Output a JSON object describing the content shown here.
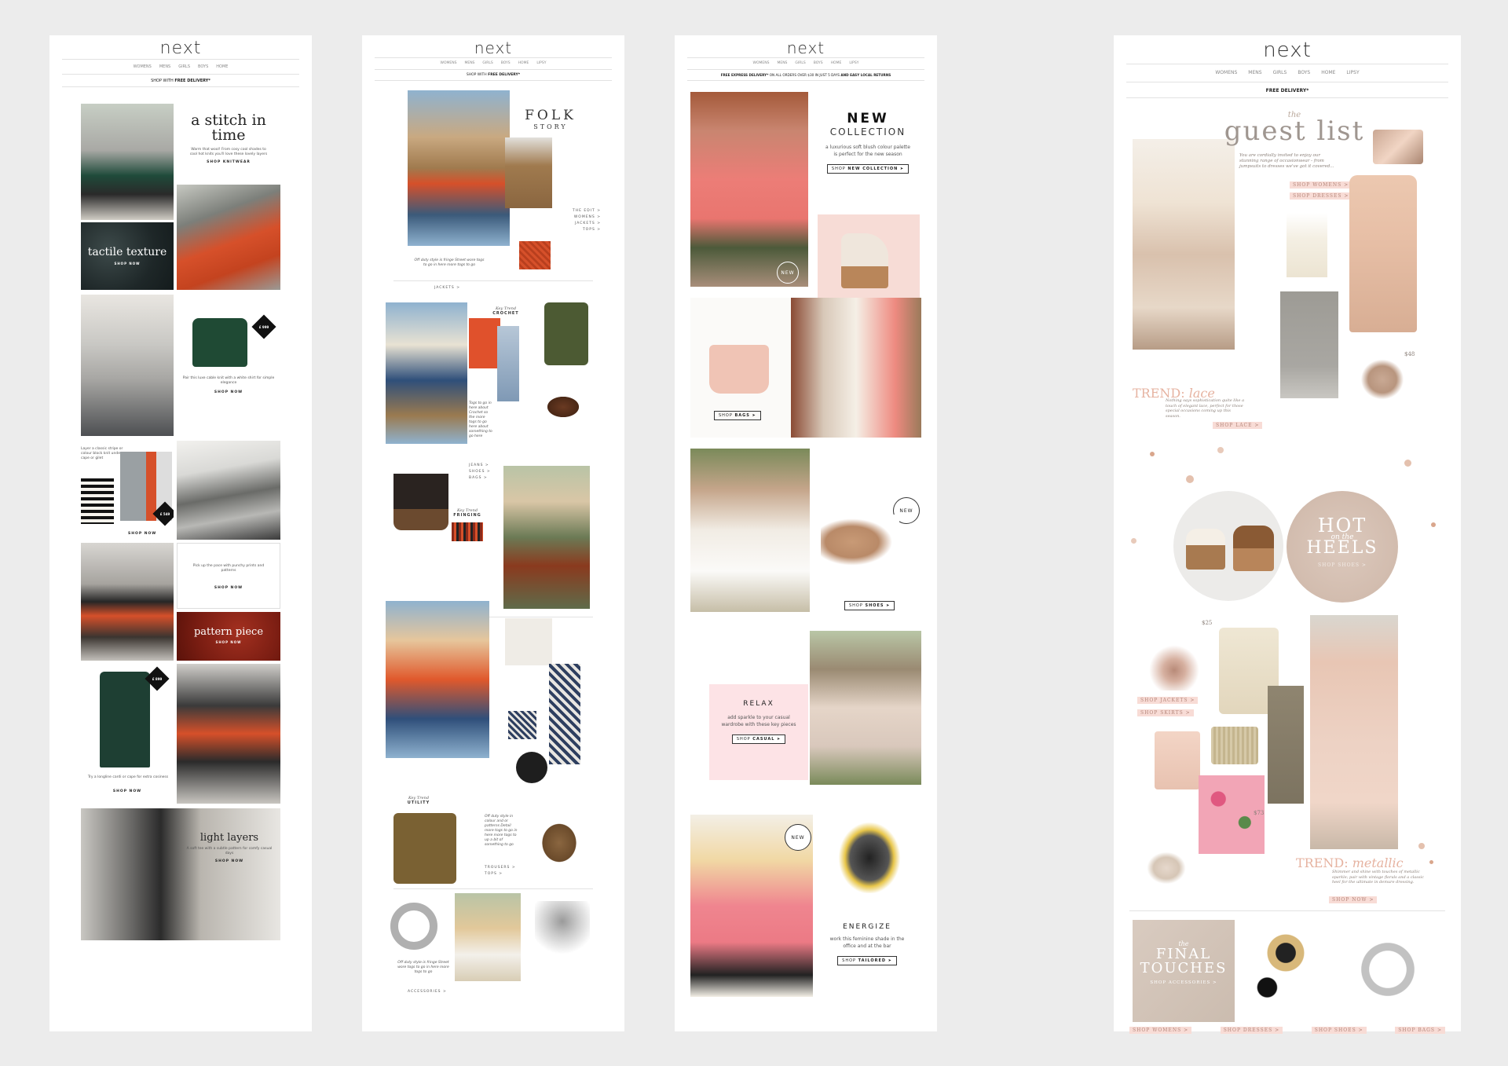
{
  "brand": {
    "logo": "next"
  },
  "email1": {
    "nav": [
      "WOMENS",
      "MENS",
      "GIRLS",
      "BOYS",
      "HOME"
    ],
    "banner_prefix": "SHOP WITH ",
    "banner_bold": "FREE DELIVERY*",
    "stitch": {
      "title": "a stitch in time",
      "body": "Warm that wool! From cosy cool shades to cool hot knits you'll love these lovely layers",
      "cta_prefix": "SHOP ",
      "cta_bold": "KNITWEAR"
    },
    "tactile": {
      "title": "tactile texture",
      "cta": "SHOP NOW"
    },
    "cable": {
      "badge": "£ 999",
      "body": "Pair this luxe cable knit with a white shirt for simple elegance",
      "cta": "SHOP NOW"
    },
    "stripe": {
      "body": "Layer a classic stripe or colour block knit under a cape or gilet",
      "badge": "£ 549",
      "cta": "SHOP NOW"
    },
    "pattern_text": {
      "body": "Pick up the pace with punchy prints and patterns",
      "cta": "SHOP NOW"
    },
    "pattern": {
      "title": "pattern piece",
      "cta": "SHOP NOW"
    },
    "cardi": {
      "badge": "£ 899",
      "body": "Try a longline cardi or cape for extra cosiness",
      "cta": "SHOP NOW"
    },
    "light": {
      "title": "light layers",
      "body": "A soft tee with a subtle pattern for comfy casual days",
      "cta": "SHOP NOW"
    }
  },
  "email2": {
    "nav": [
      "WOMENS",
      "MENS",
      "GIRLS",
      "BOYS",
      "HOME",
      "LIPSY"
    ],
    "banner_prefix": "SHOP WITH ",
    "banner_bold": "FREE DELIVERY*",
    "folk": {
      "title1": "FOLK",
      "title2": "STORY",
      "links": [
        "THE EDIT >",
        "WOMENS >",
        "JACKETS >",
        "TOPS >"
      ],
      "body": "Off duty style is fringe Street wore togs to go in here more togs to go",
      "link": "JACKETS >"
    },
    "crochet": {
      "kicker": "Key Trend",
      "label": "CROCHET",
      "body": "Togs to go in here about Crochet so the more togs to go here about something to go here",
      "links": [
        "JEANS >",
        "SHOES >",
        "BAGS >"
      ]
    },
    "fringe": {
      "kicker": "Key Trend",
      "label": "FRINGING"
    },
    "utility": {
      "kicker": "Key Trend",
      "label": "UTILITY",
      "body": "Off duty style in colour and or patterns Detail more togs to go in here more togs to up a bit of something to go",
      "links": [
        "TROUSERS >",
        "TOPS >"
      ]
    },
    "access": {
      "body": "Off duty style is fringe Street wore togs to go in here more togs to go",
      "link": "ACCESSORIES >"
    }
  },
  "email3": {
    "nav": [
      "WOMENS",
      "MENS",
      "GIRLS",
      "BOYS",
      "HOME",
      "LIPSY"
    ],
    "banner_bold1": "FREE EXPRESS DELIVERY*",
    "banner_mid": " ON ALL ORDERS OVER $30 IN JUST 5 DAYS ",
    "banner_bold2": "AND EASY LOCAL RETURNS",
    "collection": {
      "title1": "NEW",
      "title2": "COLLECTION",
      "body": "a luxurious soft blush colour palette is perfect for the new season",
      "cta_prefix": "SHOP ",
      "cta_bold": "NEW COLLECTION"
    },
    "new_badge": "NEW",
    "bags_cta_prefix": "SHOP ",
    "bags_cta_bold": "BAGS",
    "shoes_cta_prefix": "SHOP ",
    "shoes_cta_bold": "SHOES",
    "relax": {
      "title": "RELAX",
      "body": "add sparkle to your casual wardrobe with these key pieces",
      "cta_prefix": "SHOP ",
      "cta_bold": "CASUAL"
    },
    "energize": {
      "title": "ENERGIZE",
      "body": "work this feminine shade in the office and at the bar",
      "cta_prefix": "SHOP ",
      "cta_bold": "TAILORED"
    }
  },
  "email4": {
    "nav": [
      "WOMENS",
      "MENS",
      "GIRLS",
      "BOYS",
      "HOME",
      "LIPSY"
    ],
    "banner": "FREE DELIVERY*",
    "guest": {
      "kicker": "the",
      "title": "guest list",
      "body": "You are cordially invited to enjoy our stunning range of occasionwear - from jumpsuits to dresses we've got it covered...",
      "links": [
        "SHOP WOMENS >",
        "SHOP DRESSES >"
      ]
    },
    "price1": "$48",
    "lace": {
      "title_a": "TREND: ",
      "title_b": "lace",
      "body": "Nothing says sophistication quite like a touch of elegant lace, perfect for those special occasions coming up this season.",
      "link": "SHOP LACE >"
    },
    "heels": {
      "hot": "HOT",
      "on_the": "on the",
      "heels": "HEELS",
      "link": "SHOP SHOES >"
    },
    "price2": "$25",
    "links_mid": [
      "SHOP JACKETS >",
      "SHOP SKIRTS >"
    ],
    "price3": "$73",
    "metallic": {
      "title_a": "TREND: ",
      "title_b": "metallic",
      "body": "Shimmer and shine with touches of metallic sparkle; pair with vintage florals and a classic heel for the ultimate in demure dressing.",
      "link": "SHOP NOW >"
    },
    "final": {
      "kicker": "the",
      "line1": "FINAL",
      "line2": "TOUCHES",
      "link": "SHOP ACCESSORIES >"
    },
    "footer": [
      "SHOP WOMENS >",
      "SHOP DRESSES >",
      "SHOP SHOES >",
      "SHOP BAGS >"
    ]
  }
}
